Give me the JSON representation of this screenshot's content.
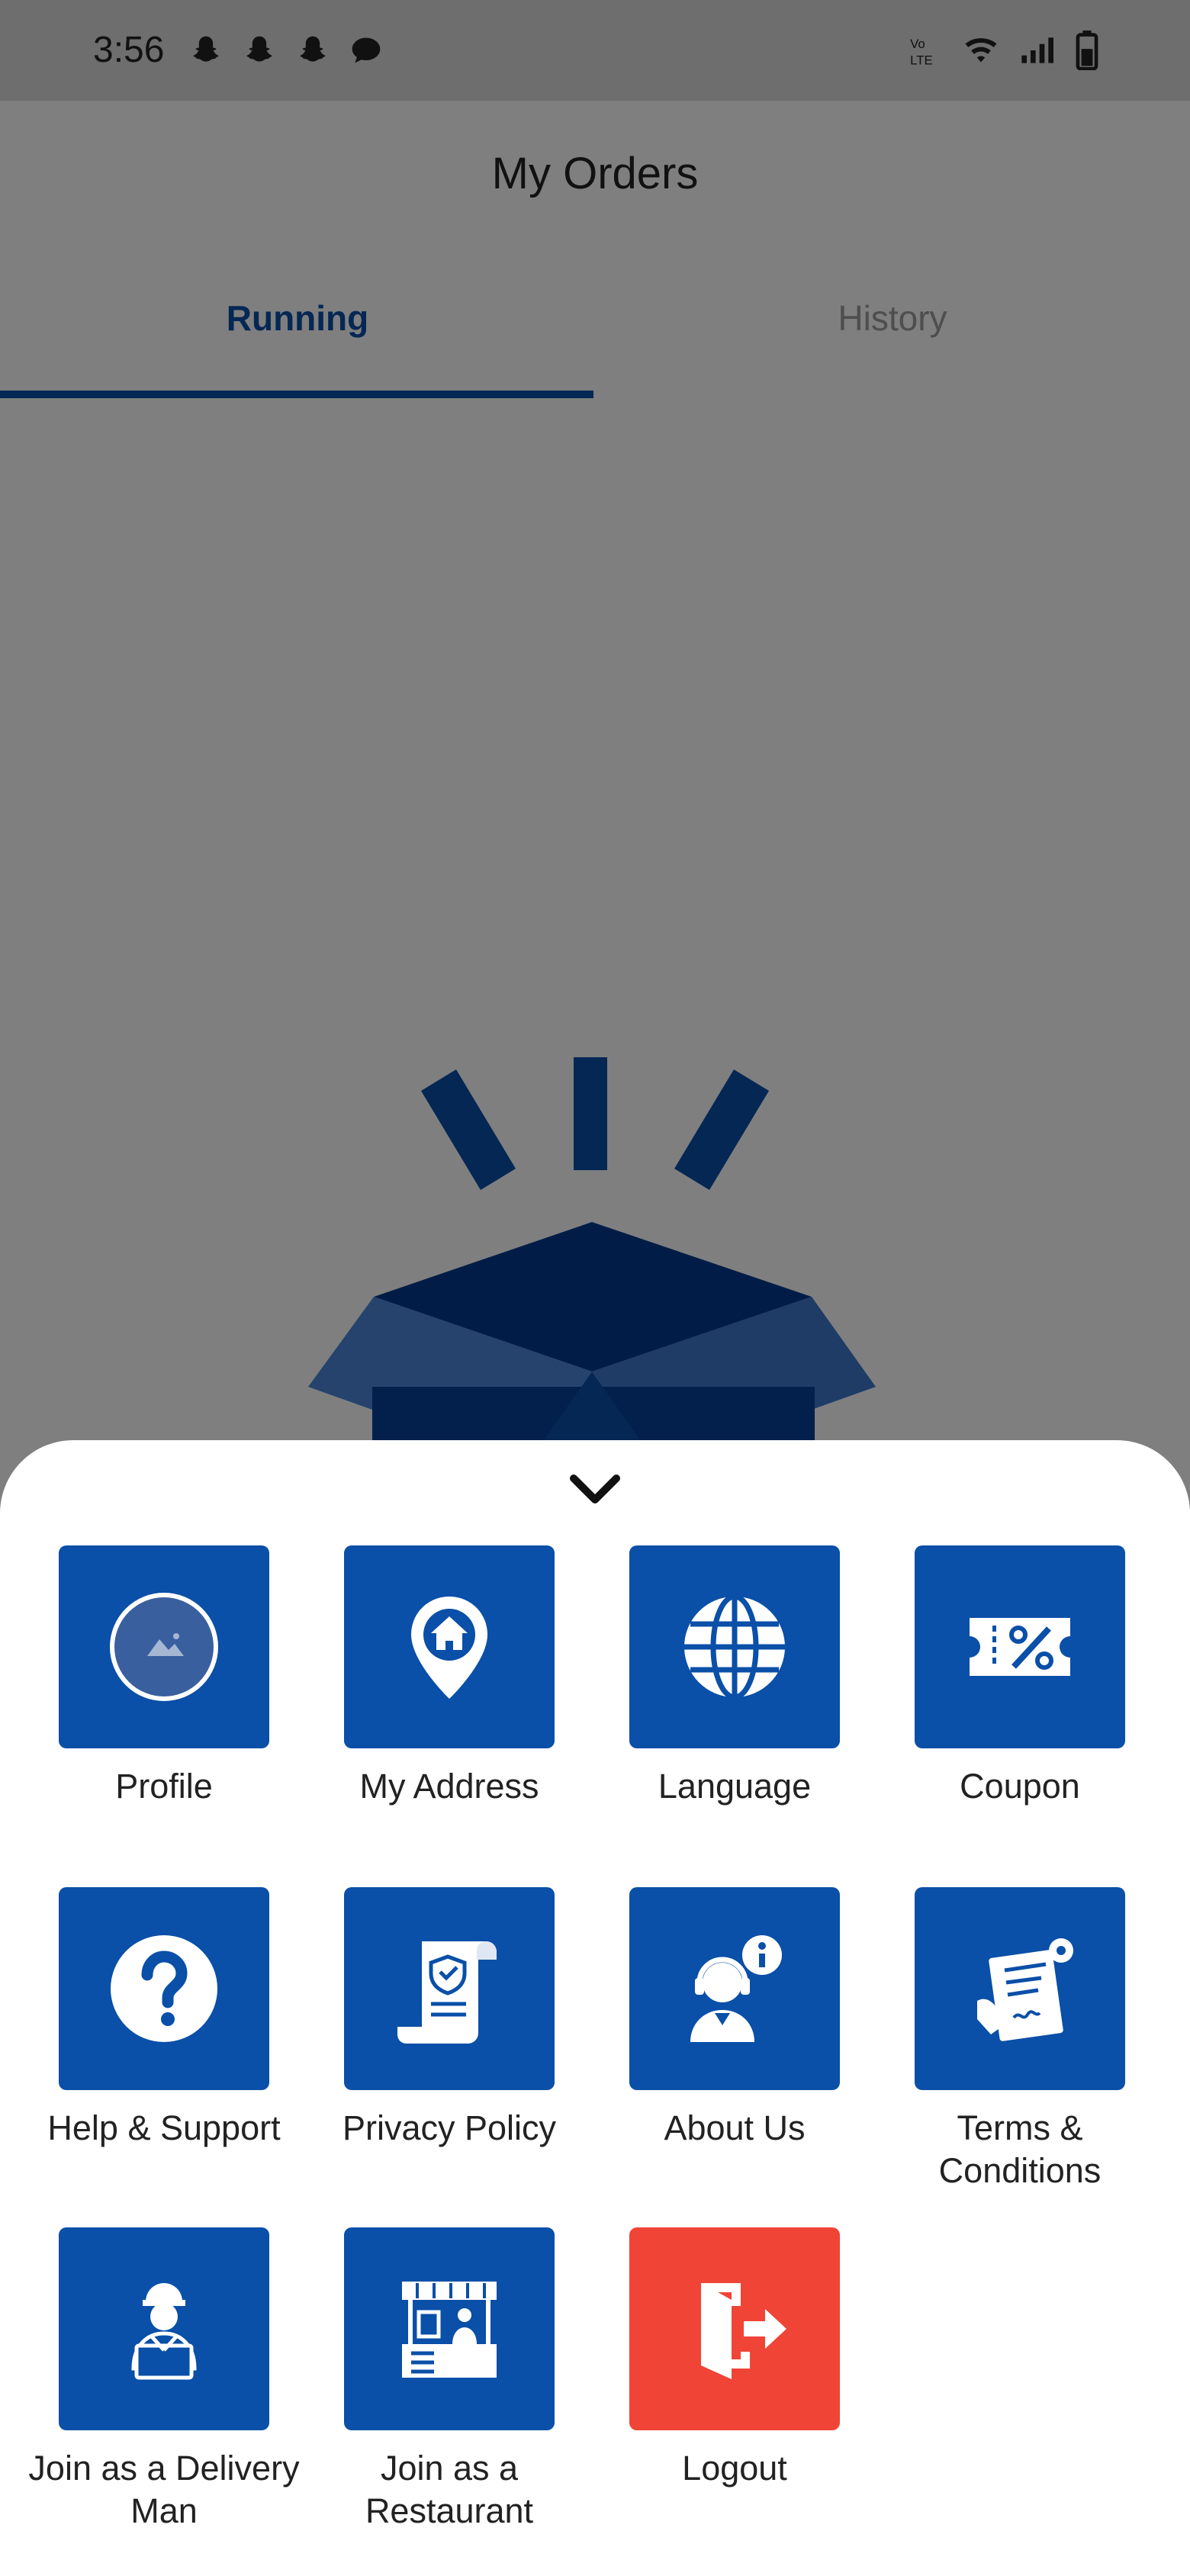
{
  "status_bar": {
    "time": "3:56",
    "notification_icons": [
      "snapchat-icon",
      "snapchat-icon",
      "snapchat-icon",
      "chat-bubble-icon"
    ],
    "system_icons": [
      "volte-icon",
      "wifi-icon",
      "signal-icon",
      "battery-icon"
    ]
  },
  "header": {
    "title": "My Orders"
  },
  "tabs": [
    {
      "label": "Running",
      "selected": true
    },
    {
      "label": "History",
      "selected": false
    }
  ],
  "menu": {
    "collapse_icon": "chevron-down-icon",
    "items": [
      {
        "label": "Profile",
        "icon": "profile-avatar-icon"
      },
      {
        "label": "My Address",
        "icon": "home-location-pin-icon"
      },
      {
        "label": "Language",
        "icon": "globe-icon"
      },
      {
        "label": "Coupon",
        "icon": "coupon-icon"
      },
      {
        "label": "Help & Support",
        "icon": "question-icon"
      },
      {
        "label": "Privacy Policy",
        "icon": "privacy-policy-icon"
      },
      {
        "label": "About Us",
        "icon": "support-agent-info-icon"
      },
      {
        "label": "Terms & Conditions",
        "icon": "terms-document-icon"
      },
      {
        "label": "Join as a Delivery Man",
        "icon": "delivery-man-icon"
      },
      {
        "label": "Join as a Restaurant",
        "icon": "restaurant-stall-icon"
      },
      {
        "label": "Logout",
        "icon": "logout-door-icon"
      }
    ]
  },
  "colors": {
    "primary": "#0a4fa8",
    "logout": "#f04436",
    "inactive_tab": "#9c9c9c"
  }
}
